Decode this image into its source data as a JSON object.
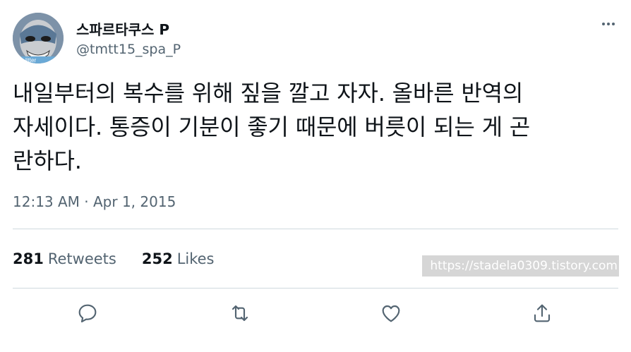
{
  "author": {
    "display_name": "스파르타쿠스 P",
    "handle": "@tmtt15_spa_P",
    "avatar_badge": "litter"
  },
  "tweet": {
    "lines": [
      "내일부터의 복수를 위해 짚을 깔고 자자. 올바른 반역의",
      "자세이다. 통증이 기분이 좋기 때문에 버릇이 되는 게 곤",
      "란하다."
    ],
    "timestamp": "12:13 AM · Apr 1, 2015"
  },
  "stats": {
    "retweets_count": "281",
    "retweets_label": "Retweets",
    "likes_count": "252",
    "likes_label": "Likes"
  },
  "watermark": "https://stadela0309.tistory.com",
  "actions": [
    {
      "name": "reply",
      "icon": "reply-icon"
    },
    {
      "name": "retweet",
      "icon": "retweet-icon"
    },
    {
      "name": "like",
      "icon": "heart-icon"
    },
    {
      "name": "share",
      "icon": "share-icon"
    }
  ],
  "colors": {
    "text_primary": "#0f1419",
    "text_secondary": "#536471",
    "divider": "#cfd9de"
  }
}
